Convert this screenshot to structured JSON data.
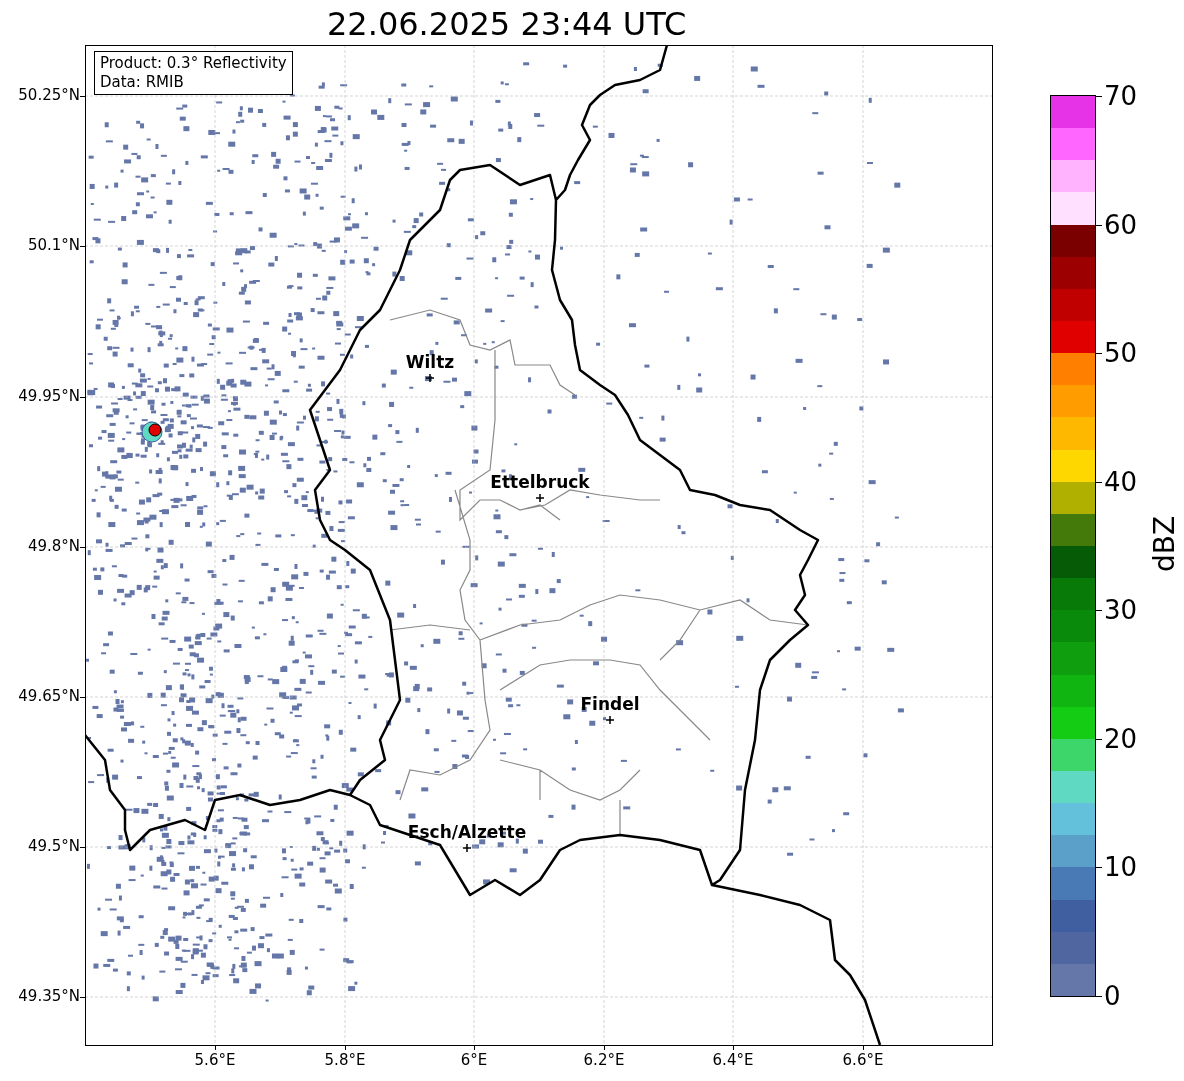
{
  "title": "22.06.2025 23:44 UTC",
  "info_box": [
    "Product: 0.3° Reflectivity",
    "Data: RMIB"
  ],
  "y_ticks": [
    "50.25°N",
    "50.1°N",
    "49.95°N",
    "49.8°N",
    "49.65°N",
    "49.5°N",
    "49.35°N"
  ],
  "x_ticks": [
    "5.6°E",
    "5.8°E",
    "6°E",
    "6.2°E",
    "6.4°E",
    "6.6°E"
  ],
  "cities": [
    {
      "name": "Wiltz"
    },
    {
      "name": "Ettelbruck"
    },
    {
      "name": "Findel"
    },
    {
      "name": "Esch/Alzette"
    }
  ],
  "colorbar": {
    "label": "dBZ",
    "ticks": [
      "70",
      "60",
      "50",
      "40",
      "30",
      "20",
      "10",
      "0"
    ],
    "segments": [
      {
        "color": "#e733e7"
      },
      {
        "color": "#ff66ff"
      },
      {
        "color": "#ffb3ff"
      },
      {
        "color": "#ffe0ff"
      },
      {
        "color": "#7a0000"
      },
      {
        "color": "#9c0000"
      },
      {
        "color": "#c00000"
      },
      {
        "color": "#e00000"
      },
      {
        "color": "#ff7f00"
      },
      {
        "color": "#ff9c00"
      },
      {
        "color": "#ffb800"
      },
      {
        "color": "#ffd700"
      },
      {
        "color": "#b0b000"
      },
      {
        "color": "#437a0a"
      },
      {
        "color": "#065c06"
      },
      {
        "color": "#077a07"
      },
      {
        "color": "#0a8a0a"
      },
      {
        "color": "#0e9e0e"
      },
      {
        "color": "#11b511"
      },
      {
        "color": "#14cc14"
      },
      {
        "color": "#3dd66b"
      },
      {
        "color": "#5fd9c2"
      },
      {
        "color": "#64c1dc"
      },
      {
        "color": "#5aa0c8"
      },
      {
        "color": "#4a7ab5"
      },
      {
        "color": "#3f5fa0"
      },
      {
        "color": "#5066a0"
      },
      {
        "color": "#6577a8"
      }
    ]
  }
}
